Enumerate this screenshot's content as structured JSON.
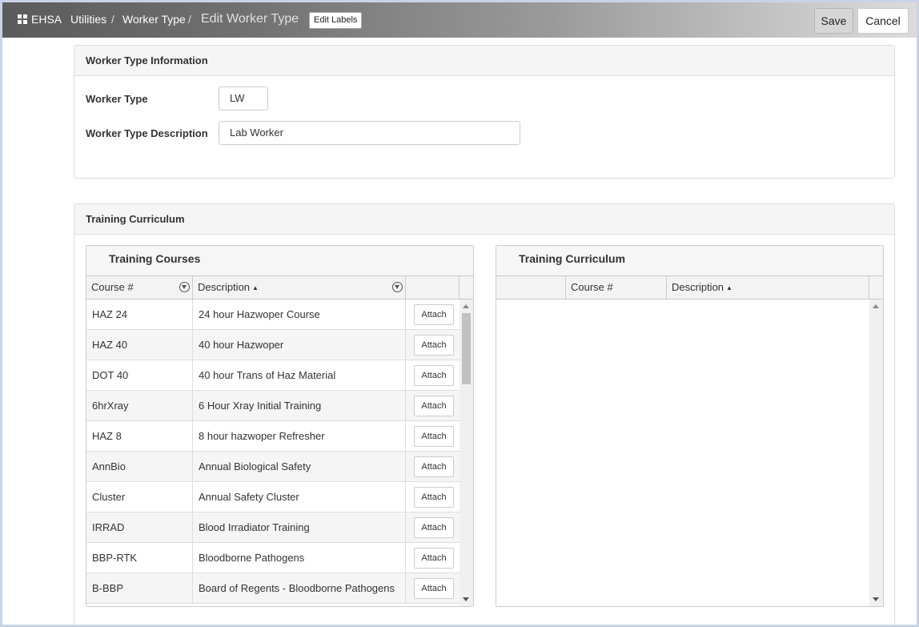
{
  "header": {
    "brand": "EHSA",
    "breadcrumbs": [
      "Utilities",
      "Worker Type"
    ],
    "separator": "/",
    "current": "Edit Worker Type",
    "edit_labels": "Edit Labels",
    "save_label": "Save",
    "cancel_label": "Cancel"
  },
  "worker_info": {
    "title": "Worker Type Information",
    "worker_type_label": "Worker Type",
    "worker_type_value": "LW",
    "description_label": "Worker Type Description",
    "description_value": "Lab Worker"
  },
  "curriculum": {
    "title": "Training Curriculum",
    "courses_grid": {
      "title": "Training Courses",
      "columns": [
        "Course #",
        "Description"
      ],
      "sort_indicator": "▲",
      "attach_label": "Attach",
      "rows": [
        {
          "course": "HAZ 24",
          "description": "24 hour Hazwoper Course"
        },
        {
          "course": "HAZ 40",
          "description": "40 hour Hazwoper"
        },
        {
          "course": "DOT 40",
          "description": "40 hour Trans of Haz Material"
        },
        {
          "course": "6hrXray",
          "description": "6 Hour Xray Initial Training"
        },
        {
          "course": "HAZ 8",
          "description": "8 hour hazwoper Refresher"
        },
        {
          "course": "AnnBio",
          "description": "Annual Biological Safety"
        },
        {
          "course": "Cluster",
          "description": "Annual Safety Cluster"
        },
        {
          "course": "IRRAD",
          "description": "Blood Irradiator Training"
        },
        {
          "course": "BBP-RTK",
          "description": "Bloodborne Pathogens"
        },
        {
          "course": "B-BBP",
          "description": "Board of Regents - Bloodborne Pathogens"
        }
      ]
    },
    "curriculum_grid": {
      "title": "Training Curriculum",
      "columns": [
        "Course #",
        "Description"
      ],
      "sort_indicator": "▲",
      "rows": []
    }
  }
}
